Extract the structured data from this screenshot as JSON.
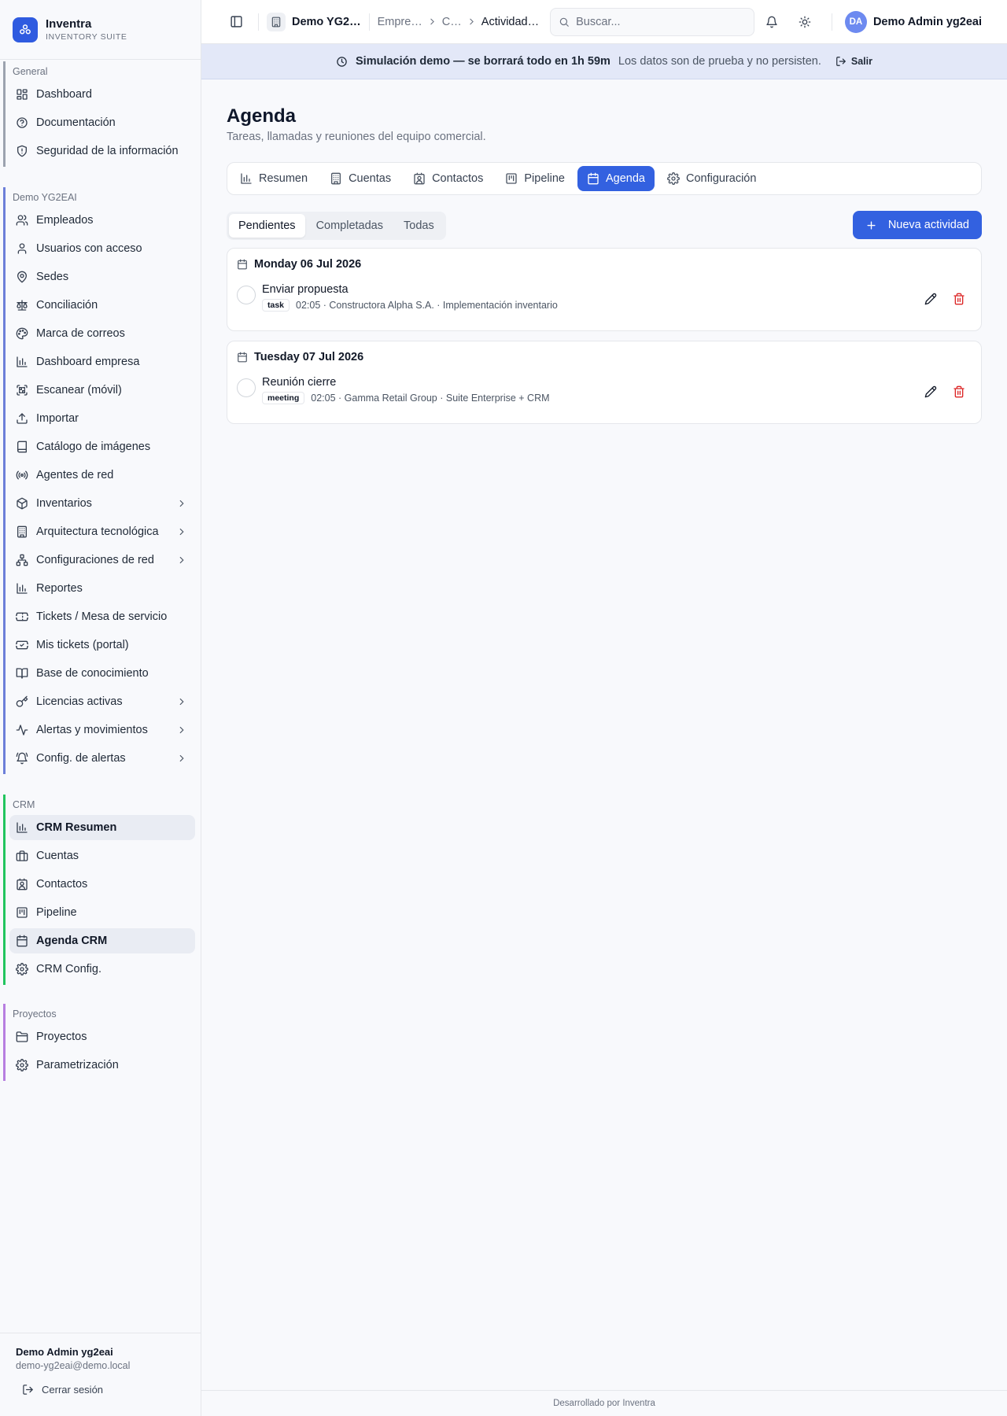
{
  "brand": {
    "name": "Inventra",
    "subtitle": "INVENTORY SUITE"
  },
  "sidebar": {
    "sections": [
      {
        "title": "General",
        "color": "#9ca3af",
        "items": [
          {
            "label": "Dashboard",
            "icon": "dashboard-icon"
          },
          {
            "label": "Documentación",
            "icon": "help-circle-icon"
          },
          {
            "label": "Seguridad de la información",
            "icon": "shield-icon"
          }
        ]
      },
      {
        "title": "Demo YG2EAI",
        "color": "#6d7fd9",
        "items": [
          {
            "label": "Empleados",
            "icon": "users-icon"
          },
          {
            "label": "Usuarios con acceso",
            "icon": "user-icon"
          },
          {
            "label": "Sedes",
            "icon": "map-pin-icon"
          },
          {
            "label": "Conciliación",
            "icon": "scale-icon"
          },
          {
            "label": "Marca de correos",
            "icon": "palette-icon"
          },
          {
            "label": "Dashboard empresa",
            "icon": "bar-chart-icon"
          },
          {
            "label": "Escanear (móvil)",
            "icon": "qr-icon"
          },
          {
            "label": "Importar",
            "icon": "upload-icon"
          },
          {
            "label": "Catálogo de imágenes",
            "icon": "book-icon"
          },
          {
            "label": "Agentes de red",
            "icon": "radio-icon"
          },
          {
            "label": "Inventarios",
            "icon": "package-icon",
            "expandable": true
          },
          {
            "label": "Arquitectura tecnológica",
            "icon": "building-icon",
            "expandable": true
          },
          {
            "label": "Configuraciones de red",
            "icon": "network-icon",
            "expandable": true
          },
          {
            "label": "Reportes",
            "icon": "bar-chart-icon"
          },
          {
            "label": "Tickets / Mesa de servicio",
            "icon": "ticket-icon"
          },
          {
            "label": "Mis tickets (portal)",
            "icon": "ticket-check-icon"
          },
          {
            "label": "Base de conocimiento",
            "icon": "book-open-icon"
          },
          {
            "label": "Licencias activas",
            "icon": "key-icon",
            "expandable": true
          },
          {
            "label": "Alertas y movimientos",
            "icon": "activity-icon",
            "expandable": true
          },
          {
            "label": "Config. de alertas",
            "icon": "bell-ring-icon",
            "expandable": true
          }
        ]
      },
      {
        "title": "CRM",
        "color": "#22c55e",
        "items": [
          {
            "label": "CRM Resumen",
            "icon": "bar-chart-icon",
            "active": true
          },
          {
            "label": "Cuentas",
            "icon": "briefcase-icon"
          },
          {
            "label": "Contactos",
            "icon": "contact-icon"
          },
          {
            "label": "Pipeline",
            "icon": "kanban-icon"
          },
          {
            "label": "Agenda CRM",
            "icon": "calendar-icon",
            "active": true
          },
          {
            "label": "CRM Config.",
            "icon": "gear-icon"
          }
        ]
      },
      {
        "title": "Proyectos",
        "color": "#b77ee0",
        "items": [
          {
            "label": "Proyectos",
            "icon": "folder-icon"
          },
          {
            "label": "Parametrización",
            "icon": "gear-icon"
          }
        ]
      }
    ],
    "footer": {
      "user": "Demo Admin yg2eai",
      "email": "demo-yg2eai@demo.local",
      "logout": "Cerrar sesión"
    }
  },
  "topbar": {
    "company": "Demo YG2…",
    "breadcrumbs": [
      "Empre…",
      "C…",
      "Actividad…"
    ],
    "search_placeholder": "Buscar...",
    "avatar_initials": "DA",
    "user_name": "Demo Admin yg2eai"
  },
  "banner": {
    "strong": "Simulación demo — se borrará todo en 1h 59m",
    "note": "Los datos son de prueba y no persisten.",
    "exit": "Salir"
  },
  "page": {
    "title": "Agenda",
    "subtitle": "Tareas, llamadas y reuniones del equipo comercial.",
    "tabs": [
      {
        "label": "Resumen",
        "icon": "bar-chart-icon"
      },
      {
        "label": "Cuentas",
        "icon": "building-icon"
      },
      {
        "label": "Contactos",
        "icon": "contact-icon"
      },
      {
        "label": "Pipeline",
        "icon": "kanban-icon"
      },
      {
        "label": "Agenda",
        "icon": "calendar-icon",
        "active": true
      },
      {
        "label": "Configuración",
        "icon": "gear-icon"
      }
    ],
    "filters": [
      {
        "label": "Pendientes",
        "active": true
      },
      {
        "label": "Completadas"
      },
      {
        "label": "Todas"
      }
    ],
    "new_button": "Nueva actividad",
    "days": [
      {
        "date": "Monday 06 Jul 2026",
        "activities": [
          {
            "title": "Enviar propuesta",
            "type": "task",
            "meta": "02:05 · Constructora Alpha S.A. · Implementación inventario"
          }
        ]
      },
      {
        "date": "Tuesday 07 Jul 2026",
        "activities": [
          {
            "title": "Reunión cierre",
            "type": "meeting",
            "meta": "02:05 · Gamma Retail Group · Suite Enterprise + CRM"
          }
        ]
      }
    ]
  },
  "footer": {
    "text": "Desarrollado por Inventra"
  },
  "colors": {
    "accent": "#3361e0",
    "danger": "#dc2626"
  }
}
